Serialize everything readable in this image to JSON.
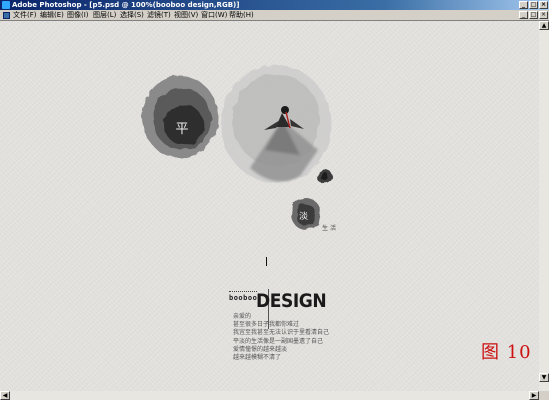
{
  "titlebar": {
    "title": "Adobe Photoshop - [p5.psd @ 100%(booboo         design,RGB)]",
    "minimize_glyph": "_",
    "maximize_glyph": "□",
    "close_glyph": "×"
  },
  "menubar": {
    "items": [
      "文件(F)",
      "编辑(E)",
      "图像(I)",
      "图层(L)",
      "选择(S)",
      "滤镜(T)",
      "视图(V)",
      "窗口(W)",
      "帮助(H)"
    ],
    "doc_minimize_glyph": "_",
    "doc_maximize_glyph": "□",
    "doc_close_glyph": "×"
  },
  "artwork": {
    "char_ping": "平",
    "char_shui": "淡",
    "shenghuo": "生活",
    "design_small": "booboo",
    "design_main": "DESIGN",
    "poem": [
      "亲爱的",
      "甚至很多日子我都你难过",
      "我宜至我甚至无法认识于里看清自己",
      "平淡的生活像是一副国墨遗了自己",
      "爱情憧憬的越来越淡",
      "越来越模糊不清了"
    ]
  },
  "figure_label": "图 10",
  "colors": {
    "title_active": "#0a246a",
    "figure_label": "#cc1111",
    "canvas": "#e4e3e0"
  }
}
